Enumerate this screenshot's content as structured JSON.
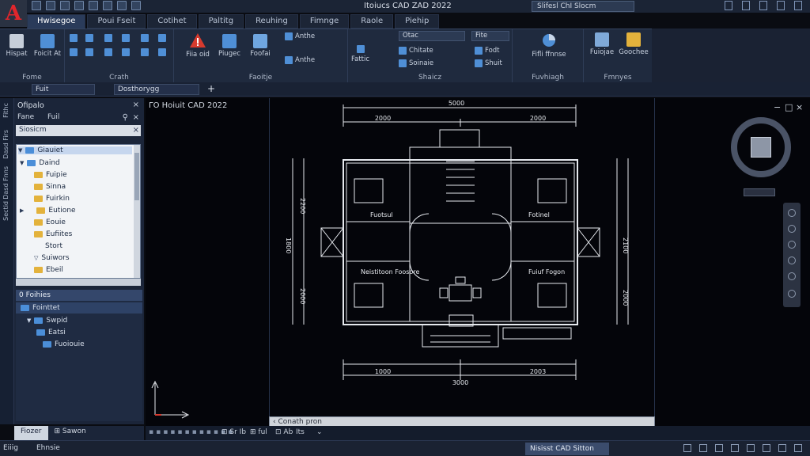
{
  "app": {
    "logo_letter": "A",
    "title": "Itoiucs CAD ZAD 2022",
    "search_text": "Slifesl ChI Slocm"
  },
  "ribbon_tabs": [
    "Hwisegoe",
    "Poui Fseit",
    "Cotihet",
    "Paltitg",
    "Reuhing",
    "Fimnge",
    "Raole",
    "Piehip"
  ],
  "ribbon": {
    "groups": [
      {
        "label": "Fome",
        "buttons": [
          "Hispat",
          "Foicit At"
        ]
      },
      {
        "label": "Crath"
      },
      {
        "label": "Faoitje",
        "buttons": [
          "Fiia oid",
          "Piugec",
          "Foofai",
          "Anthe",
          "Anthe"
        ]
      },
      {
        "label": "Shaicz",
        "dropdowns": [
          "Otac",
          "Fite"
        ],
        "buttons": [
          "Fattic",
          "Chitate",
          "Soinaie",
          "Fodt",
          "Shuit"
        ]
      },
      {
        "label": "Fuvhiagh",
        "buttons": [
          "Fifli  ffnnse"
        ]
      },
      {
        "label": "Fmnyes",
        "buttons": [
          "Fuiojae",
          "Goochee"
        ]
      }
    ]
  },
  "subbar": {
    "field1": "Fuit",
    "field2": "Dosthorygg"
  },
  "side_strip": [
    "Fithc",
    "Dasd Firs",
    "Dasd Fnns",
    "Sectid"
  ],
  "left_panel": {
    "header": "Ofipalo",
    "filter_label": "Fane",
    "filter_value": "Fuil",
    "search": "Siosicm",
    "tree": [
      {
        "label": "Giauiet",
        "color": "blue",
        "level": 0
      },
      {
        "label": "Daind",
        "color": "blue",
        "level": 1
      },
      {
        "label": "Fuipie",
        "color": "yellow",
        "level": 2
      },
      {
        "label": "Sinna",
        "color": "yellow",
        "level": 2
      },
      {
        "label": "Fuirkin",
        "color": "yellow",
        "level": 2
      },
      {
        "label": "Eutione",
        "color": "yellow",
        "level": 1
      },
      {
        "label": "Eouie",
        "color": "yellow",
        "level": 2
      },
      {
        "label": "Eufiites",
        "color": "yellow",
        "level": 2
      },
      {
        "label": "Stort",
        "color": "none",
        "level": 3
      },
      {
        "label": "Suiwors",
        "color": "none",
        "level": 2
      },
      {
        "label": "Ebeil",
        "color": "yellow",
        "level": 2
      }
    ],
    "section2_header": "0 Foihies",
    "section2_items": [
      "Fointtet",
      "Swpid",
      "Eatsi",
      "Fuoiouie"
    ],
    "bottom_tabs": [
      "Fiozer",
      "Sawon"
    ]
  },
  "canvas": {
    "title": "ΓΟ Hoiuit CAD 2022",
    "command_line": "Conath pron"
  },
  "drawing": {
    "dim_top": "5000",
    "dim_top_left": "2000",
    "dim_top_right": "2000",
    "dim_bottom": "3000",
    "dim_bottom_left": "1000",
    "dim_bottom_right": "2003",
    "dim_left_1": "2200",
    "dim_left_2": "1800",
    "dim_left_3": "2000",
    "dim_right_1": "2100",
    "dim_right_2": "2000",
    "rooms": [
      "Fuotsul",
      "Fotinel",
      "Neistitoon\nFoosore",
      "Fuiuf Fogon"
    ]
  },
  "layout_row": [
    "Sr Ib",
    "ful",
    "Ab",
    "Its"
  ],
  "status": {
    "left1": "Eiiig",
    "left2": "Ehnsie",
    "workspace": "Nisisst CAD Sitton"
  }
}
